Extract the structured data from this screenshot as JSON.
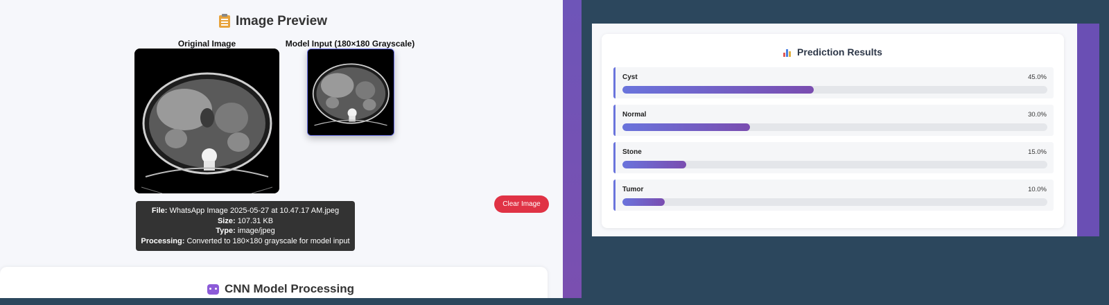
{
  "preview": {
    "title": "Image Preview",
    "original_label": "Original Image",
    "model_label": "Model Input (180×180 Grayscale)",
    "clear_button": "Clear Image",
    "file_info": {
      "file_key": "File:",
      "file_value": "WhatsApp Image 2025-05-27 at 10.47.17 AM.jpeg",
      "size_key": "Size:",
      "size_value": "107.31 KB",
      "type_key": "Type:",
      "type_value": "image/jpeg",
      "processing_key": "Processing:",
      "processing_value": "Converted to 180×180 grayscale for model input"
    }
  },
  "cnn": {
    "title": "CNN Model Processing"
  },
  "results": {
    "title": "Prediction Results",
    "items": [
      {
        "label": "Cyst",
        "percent_text": "45.0%",
        "value": 0.45
      },
      {
        "label": "Normal",
        "percent_text": "30.0%",
        "value": 0.3
      },
      {
        "label": "Stone",
        "percent_text": "15.0%",
        "value": 0.15
      },
      {
        "label": "Tumor",
        "percent_text": "10.0%",
        "value": 0.1
      }
    ]
  },
  "colors": {
    "accent": "#6a74dc",
    "accent_end": "#7a4db0",
    "danger": "#e03345"
  },
  "icons": {
    "preview": "clipboard-icon",
    "cnn": "robot-icon",
    "results": "bar-chart-icon"
  }
}
